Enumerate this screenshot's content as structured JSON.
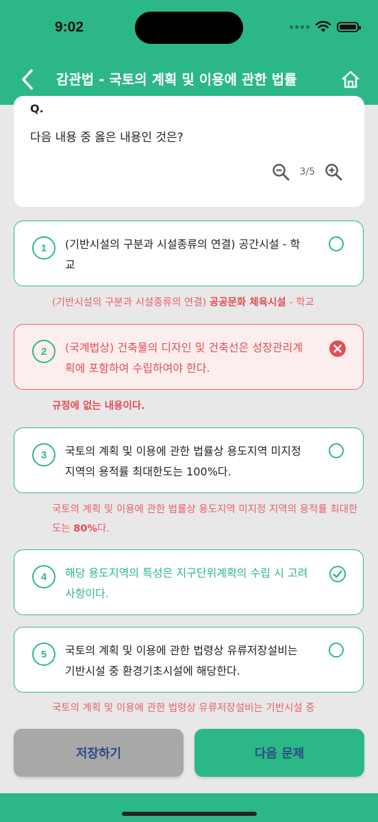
{
  "status": {
    "time": "9:02"
  },
  "nav": {
    "title": "감관법 - 국토의 계획 및 이용에 관한 법률"
  },
  "question": {
    "label": "Q.",
    "text": "다음 내용 중 옳은 내용인 것은?",
    "page": "3/5"
  },
  "options": [
    {
      "num": "1",
      "text": "(기반시설의 구분과 시설종류의 연결) 공간시설 - 학교",
      "state": "unselected"
    },
    {
      "num": "2",
      "text": "(국계법상) 건축물의 디자인 및 건축선은 성장관리계획에 포함하여 수립하여야 한다.",
      "state": "wrong"
    },
    {
      "num": "3",
      "text": "국토의 계획 및 이용에 관한 법률상 용도지역 미지정 지역의 용적률 최대한도는 100%다.",
      "state": "unselected"
    },
    {
      "num": "4",
      "text": "해당 용도지역의 특성은 지구단위계획의 수립 시 고려사항이다.",
      "state": "correct"
    },
    {
      "num": "5",
      "text": "국토의 계획 및 이용에 관한 법령상 유류저장설비는 기반시설 중 환경기초시설에 해당한다.",
      "state": "unselected"
    }
  ],
  "explanations": {
    "e1_pre": "(기반시설의 구분과 시설종류의 연결) ",
    "e1_bold": "공공문화 체육시설",
    "e1_post": " - 학교",
    "e2_bold": "규정에 없는 내용이다.",
    "e3_pre": "국토의 계획 및 이용에 관한 법률상 용도지역 미지정 지역의 용적률 최대한도는 ",
    "e3_bold": "80%",
    "e3_post": "다.",
    "e5_pre": "국토의 계획 및 이용에 관한 법령상 유류저장설비는 기반시설 중"
  },
  "buttons": {
    "save": "저장하기",
    "next": "다음 문제"
  },
  "colors": {
    "accent": "#2bb886",
    "error": "#e24e56"
  }
}
